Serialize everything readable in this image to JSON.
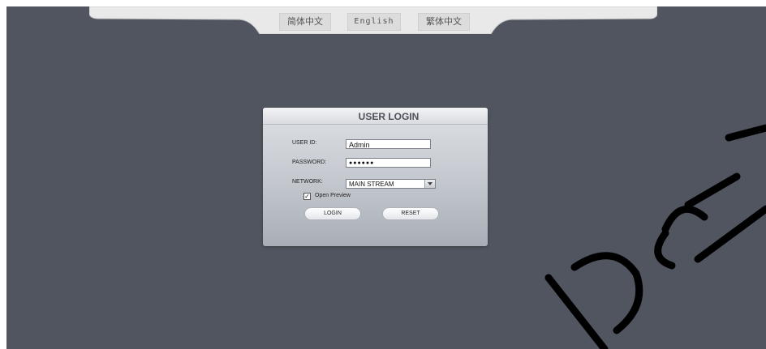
{
  "languages": [
    "简体中文",
    "English",
    "繁体中文"
  ],
  "dialog": {
    "title": "USER LOGIN",
    "user_id_label": "USER ID:",
    "user_id_value": "Admin",
    "password_label": "PASSWORD:",
    "password_value": "●●●●●●",
    "network_label": "NETWORK:",
    "network_value": "MAIN STREAM",
    "open_preview_label": "Open Preview",
    "open_preview_checked": true,
    "login_label": "LOGIN",
    "reset_label": "RESET"
  },
  "colors": {
    "background": "#51555f",
    "dialog": "#c8ccd2",
    "watermark": "#000000"
  }
}
